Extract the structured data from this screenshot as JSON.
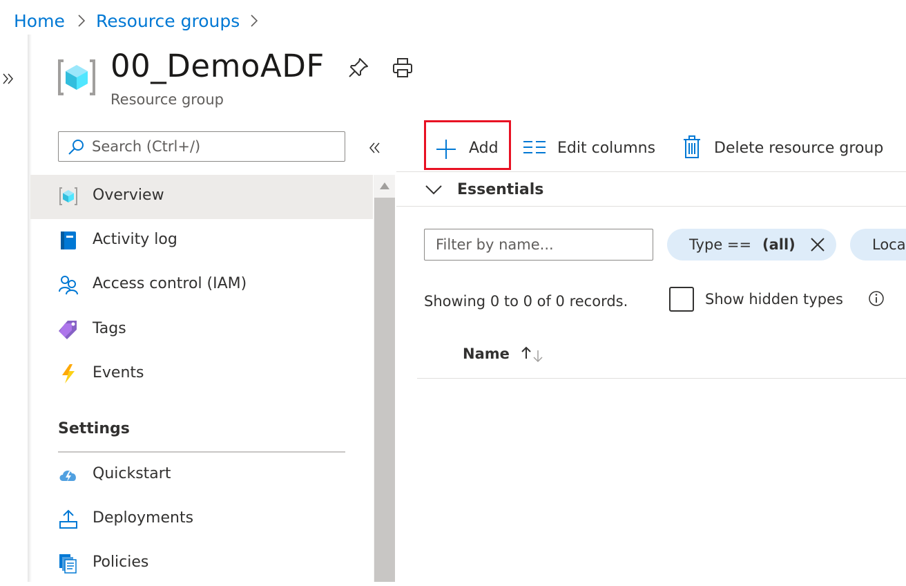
{
  "breadcrumb": {
    "items": [
      "Home",
      "Resource groups"
    ]
  },
  "header": {
    "title": "00_DemoADF",
    "subtitle": "Resource group"
  },
  "search": {
    "placeholder": "Search (Ctrl+/)"
  },
  "sidebar": {
    "items": [
      {
        "label": "Overview",
        "icon": "resource-group-icon",
        "selected": true
      },
      {
        "label": "Activity log",
        "icon": "activity-log-icon"
      },
      {
        "label": "Access control (IAM)",
        "icon": "people-icon"
      },
      {
        "label": "Tags",
        "icon": "tag-icon"
      },
      {
        "label": "Events",
        "icon": "lightning-icon"
      }
    ],
    "settings_heading": "Settings",
    "settings_items": [
      {
        "label": "Quickstart",
        "icon": "cloud-lightning-icon"
      },
      {
        "label": "Deployments",
        "icon": "upload-icon"
      },
      {
        "label": "Policies",
        "icon": "policy-documents-icon"
      }
    ]
  },
  "toolbar": {
    "add_label": "Add",
    "edit_columns_label": "Edit columns",
    "delete_label": "Delete resource group"
  },
  "essentials": {
    "label": "Essentials"
  },
  "filters": {
    "name_placeholder": "Filter by name...",
    "type_pill_prefix": "Type == ",
    "type_pill_value": "(all)",
    "location_pill_partial": "Loca"
  },
  "records": {
    "summary": "Showing 0 to 0 of 0 records.",
    "show_hidden_label": "Show hidden types",
    "show_hidden_checked": false
  },
  "grid": {
    "columns": [
      {
        "label": "Name",
        "sort": "ascending"
      }
    ]
  },
  "colors": {
    "link": "#0078d4",
    "highlight": "#e81123",
    "pill_bg": "#deecf9",
    "selected_bg": "#edebe9"
  }
}
